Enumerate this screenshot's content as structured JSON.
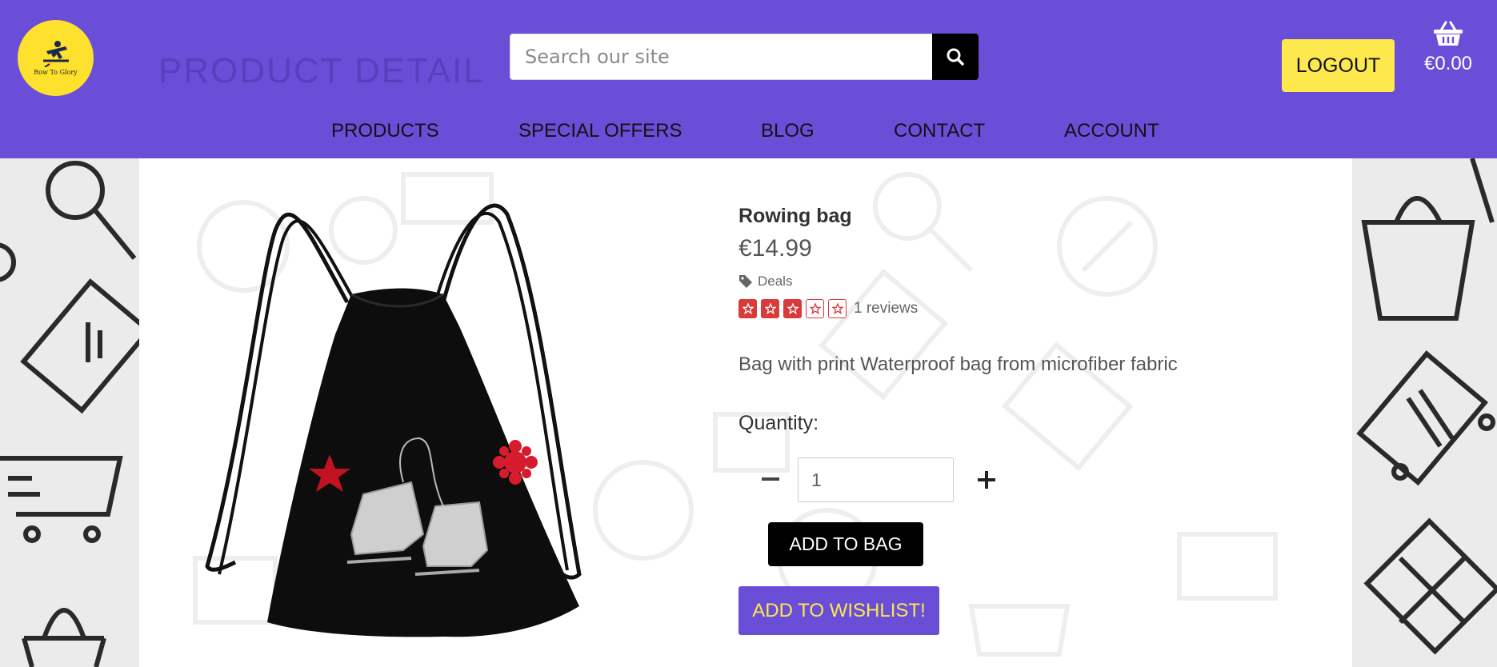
{
  "header": {
    "logo_text": "Row To Glory",
    "ghost_title": "PRODUCT DETAIL",
    "search": {
      "placeholder": "Search our site",
      "value": ""
    },
    "logout_label": "LOGOUT",
    "basket_total": "€0.00"
  },
  "nav": {
    "items": [
      {
        "label": "PRODUCTS"
      },
      {
        "label": "SPECIAL OFFERS"
      },
      {
        "label": "BLOG"
      },
      {
        "label": "CONTACT"
      },
      {
        "label": "ACCOUNT"
      }
    ]
  },
  "product": {
    "name": "Rowing bag",
    "price": "€14.99",
    "category": "Deals",
    "rating": {
      "filled": 3,
      "total": 5
    },
    "reviews_label": "1 reviews",
    "description": "Bag with print Waterproof bag from microfiber fabric",
    "quantity_label": "Quantity:",
    "quantity_value": "1",
    "add_to_bag_label": "ADD TO BAG",
    "add_to_wishlist_label": "ADD TO WISHLIST!"
  },
  "colors": {
    "brand_purple": "#6a4ed8",
    "logo_yellow": "#fde12d",
    "button_yellow": "#fde84d",
    "star_red": "#d93a3a"
  },
  "icons": {
    "search": "search-icon",
    "basket": "basket-icon",
    "tag": "tag-icon",
    "star": "star-icon",
    "minus": "minus-icon",
    "plus": "plus-icon"
  }
}
